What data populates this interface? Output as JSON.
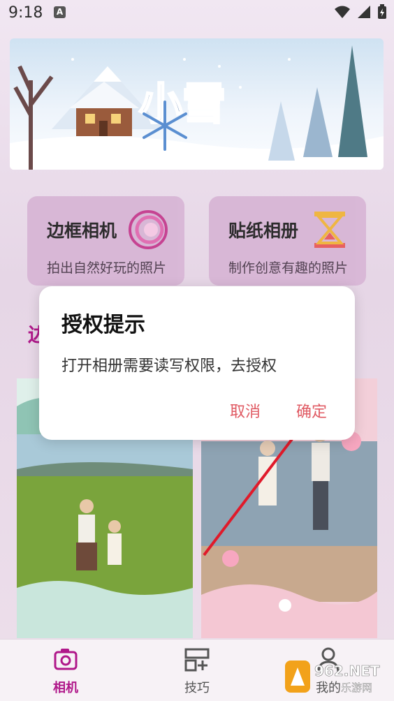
{
  "status_bar": {
    "time": "9:18",
    "notif_badge": "A"
  },
  "feature_cards": [
    {
      "title": "边框相机",
      "subtitle": "拍出自然好玩的照片",
      "icon": "swirl-ring-icon"
    },
    {
      "title": "贴纸相册",
      "subtitle": "制作创意有趣的照片",
      "icon": "hourglass-icon"
    }
  ],
  "section_partial": "边",
  "dialog": {
    "title": "授权提示",
    "message": "打开相册需要读写权限，去授权",
    "cancel": "取消",
    "confirm": "确定"
  },
  "bottom_nav": [
    {
      "label": "相机",
      "icon": "camera-icon",
      "active": true
    },
    {
      "label": "技巧",
      "icon": "tips-icon",
      "active": false
    },
    {
      "label": "我的",
      "icon": "profile-icon",
      "active": false
    }
  ],
  "watermark": {
    "brand": "962.NET",
    "sub": "乐游网"
  },
  "colors": {
    "accent": "#b0188a",
    "dialog_button": "#e05a63",
    "card": "#d8b6d6"
  }
}
